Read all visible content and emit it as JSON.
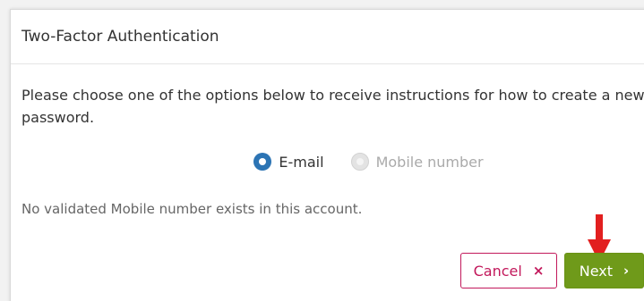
{
  "dialog": {
    "title": "Two-Factor Authentication",
    "instructions": "Please choose one of the options below to receive instructions for how to create a new password.",
    "options": [
      {
        "label": "E-mail",
        "selected": true,
        "enabled": true
      },
      {
        "label": "Mobile number",
        "selected": false,
        "enabled": false
      }
    ],
    "notice": "No validated Mobile number exists in this account.",
    "cancel_label": "Cancel",
    "cancel_icon": "×",
    "next_label": "Next",
    "next_icon": "›"
  },
  "colors": {
    "primary_radio": "#2c74b4",
    "cancel": "#c2185b",
    "next": "#6f9a1a",
    "arrow": "#e21f1f"
  },
  "icons": [
    "close-icon",
    "chevron-right-icon",
    "red-arrow-annotation"
  ]
}
